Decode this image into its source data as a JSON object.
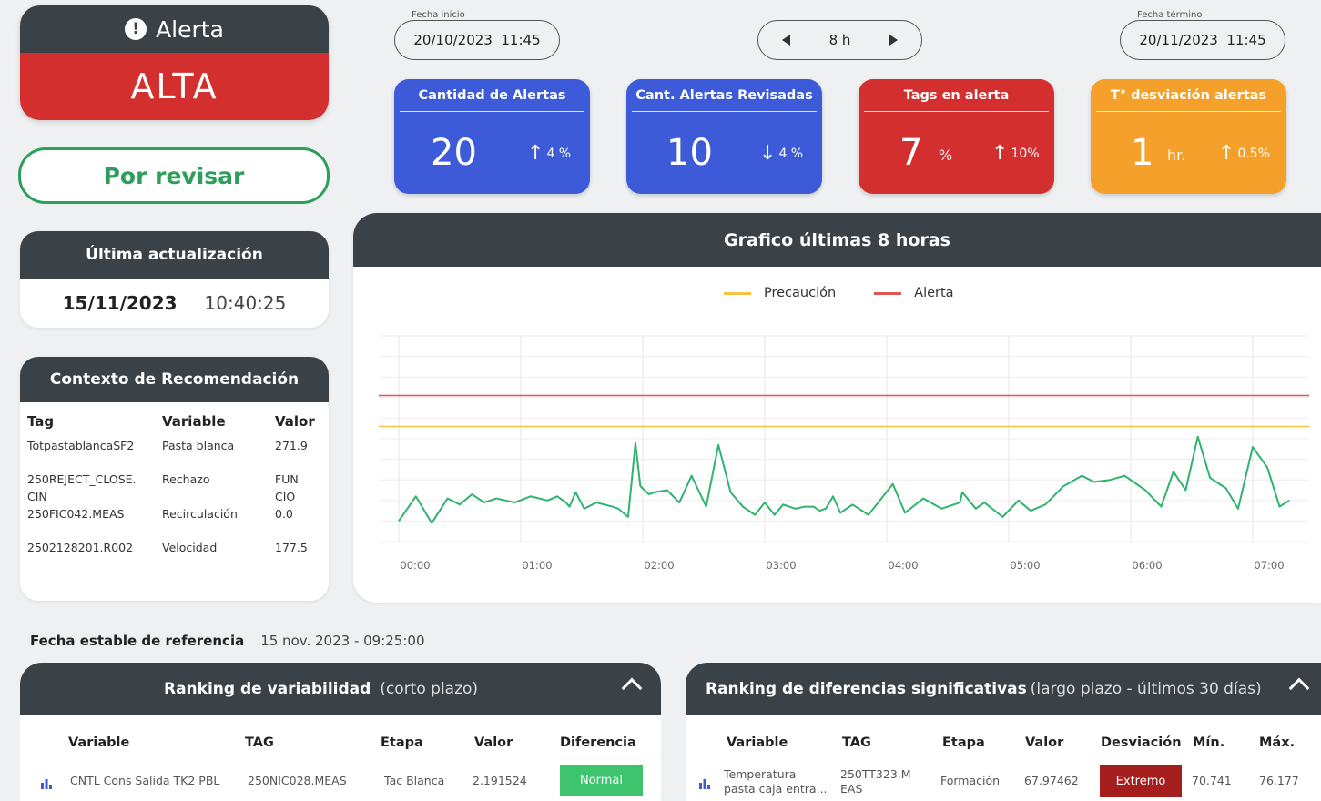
{
  "alert": {
    "title": "Alerta",
    "level": "ALTA"
  },
  "review_button": "Por revisar",
  "last_update": {
    "title": "Última actualización",
    "date": "15/11/2023",
    "time": "10:40:25"
  },
  "context": {
    "title": "Contexto de Recomendación",
    "headers": [
      "Tag",
      "Variable",
      "Valor"
    ],
    "rows": [
      [
        "TotpastablancaSF2",
        "Pasta blanca",
        "271.9"
      ],
      [
        "250REJECT_CLOSE.\nCIN",
        "Rechazo",
        "FUN\nCIO"
      ],
      [
        "250FIC042.MEAS",
        "Recirculación",
        "0.0"
      ],
      [
        "2502128201.R002",
        "Velocidad",
        "177.5"
      ]
    ]
  },
  "date_start": {
    "label": "Fecha inicio",
    "value": "20/10/2023  11:45"
  },
  "date_end": {
    "label": "Fecha término",
    "value": "20/11/2023  11:45"
  },
  "range": {
    "value": "8 h"
  },
  "kpis": [
    {
      "title": "Cantidad de Alertas",
      "value": "20",
      "unit": "",
      "delta": "4 %",
      "dir": "up",
      "color": "#3d5bd9"
    },
    {
      "title": "Cant. Alertas Revisadas",
      "value": "10",
      "unit": "",
      "delta": "4 %",
      "dir": "down",
      "color": "#3d5bd9"
    },
    {
      "title": "Tags en alerta",
      "value": "7",
      "unit": "%",
      "delta": "10%",
      "dir": "up",
      "color": "#d32f2f"
    },
    {
      "title": "T° desviación alertas",
      "value": "1",
      "unit": "hr.",
      "delta": "0.5%",
      "dir": "up",
      "color": "#f5a02a"
    }
  ],
  "chart_title": "Grafico últimas 8 horas",
  "chart_data": {
    "type": "line",
    "title": "Grafico últimas 8 horas",
    "x_ticks": [
      "00:00",
      "01:00",
      "02:00",
      "03:00",
      "04:00",
      "05:00",
      "06:00",
      "07:00"
    ],
    "legend": [
      {
        "name": "Precaución",
        "color": "#f5c242"
      },
      {
        "name": "Alerta",
        "color": "#e05555"
      }
    ],
    "ylim": [
      0,
      10
    ],
    "thresholds": {
      "Precaución": 5.6,
      "Alerta": 7.1
    },
    "series": [
      {
        "color": "#2fb36e",
        "x": [
          0,
          0.14,
          0.27,
          0.4,
          0.5,
          0.6,
          0.7,
          0.8,
          0.95,
          1.08,
          1.22,
          1.3,
          1.37,
          1.4,
          1.45,
          1.52,
          1.62,
          1.75,
          1.8,
          1.88,
          1.94,
          1.98,
          2.05,
          2.1,
          2.2,
          2.3,
          2.4,
          2.52,
          2.62,
          2.72,
          2.82,
          2.92,
          3.0,
          3.08,
          3.15,
          3.25,
          3.33,
          3.4,
          3.45,
          3.5,
          3.56,
          3.62,
          3.72,
          3.85,
          4.05,
          4.15,
          4.3,
          4.45,
          4.6,
          4.62,
          4.73,
          4.8,
          4.95,
          5.08,
          5.18,
          5.3,
          5.45,
          5.6,
          5.7,
          5.83,
          5.95,
          6.12,
          6.25,
          6.35,
          6.45,
          6.55,
          6.65,
          6.78,
          6.88,
          7.0,
          7.12,
          7.22,
          7.3
        ],
        "y": [
          1.0,
          2.2,
          0.9,
          2.1,
          1.8,
          2.3,
          1.9,
          2.1,
          1.9,
          2.2,
          2.0,
          2.2,
          1.9,
          1.7,
          2.4,
          1.6,
          1.9,
          1.7,
          1.6,
          1.2,
          4.8,
          2.7,
          2.3,
          2.4,
          2.5,
          1.9,
          3.2,
          1.7,
          4.7,
          2.4,
          1.7,
          1.3,
          1.9,
          1.3,
          1.8,
          1.6,
          1.7,
          1.7,
          1.5,
          1.6,
          2.2,
          1.4,
          1.8,
          1.3,
          2.8,
          1.4,
          2.1,
          1.6,
          1.9,
          2.4,
          1.6,
          1.9,
          1.2,
          2.0,
          1.5,
          1.8,
          2.7,
          3.2,
          2.9,
          3.0,
          3.2,
          2.5,
          1.7,
          3.4,
          2.5,
          5.1,
          3.1,
          2.6,
          1.6,
          4.6,
          3.6,
          1.7,
          2.0
        ]
      }
    ]
  },
  "reference": {
    "label": "Fecha estable de referencia",
    "value": "15 nov. 2023 - 09:25:00"
  },
  "ranking_var": {
    "title": "Ranking de variabilidad",
    "subtitle": "(corto plazo)",
    "headers": [
      "Variable",
      "TAG",
      "Etapa",
      "Valor",
      "Diferencia"
    ],
    "row": [
      "CNTL Cons Salida TK2 PBL",
      "250NIC028.MEAS",
      "Tac Blanca",
      "2.191524",
      "Normal"
    ],
    "badge_color": "#3ec46d"
  },
  "ranking_diff": {
    "title": "Ranking de diferencias significativas",
    "subtitle": "(largo plazo - últimos 30 días)",
    "headers": [
      "Variable",
      "TAG",
      "Etapa",
      "Valor",
      "Desviación",
      "Mín.",
      "Máx."
    ],
    "row": [
      "Temperatura\npasta caja entra...",
      "250TT323.M\nEAS",
      "Formación",
      "67.97462",
      "Extremo",
      "70.741",
      "76.177"
    ],
    "badge_color": "#a51d1d"
  }
}
